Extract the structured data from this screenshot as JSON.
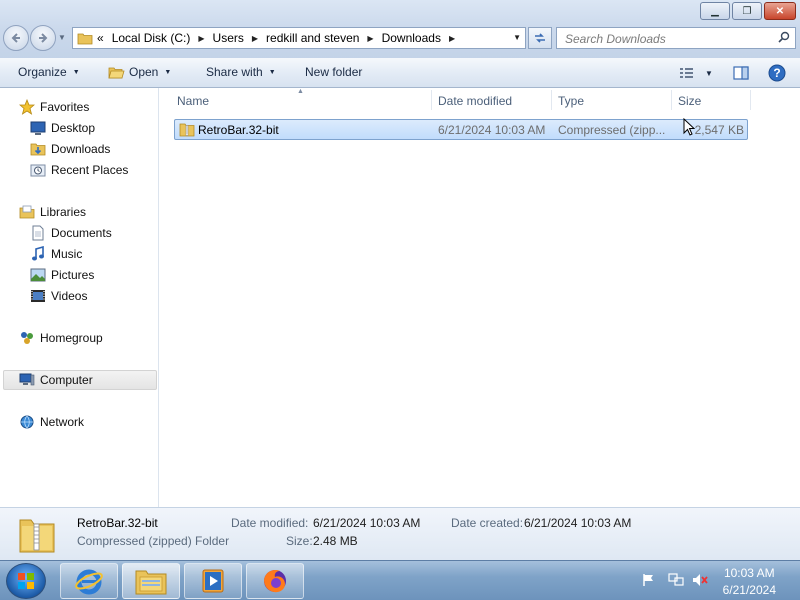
{
  "window": {
    "minimize": "▁",
    "maximize": "❐",
    "close": "✕"
  },
  "address": {
    "overflow": "«",
    "crumbs": [
      "Local Disk (C:)",
      "Users",
      "redkill and steven",
      "Downloads"
    ],
    "search_placeholder": "Search Downloads"
  },
  "toolbar": {
    "organize": "Organize",
    "open": "Open",
    "share_with": "Share with",
    "new_folder": "New folder"
  },
  "nav": {
    "favorites": "Favorites",
    "desktop": "Desktop",
    "downloads": "Downloads",
    "recent_places": "Recent Places",
    "libraries": "Libraries",
    "documents": "Documents",
    "music": "Music",
    "pictures": "Pictures",
    "videos": "Videos",
    "homegroup": "Homegroup",
    "computer": "Computer",
    "network": "Network"
  },
  "columns": {
    "name": "Name",
    "date_modified": "Date modified",
    "type": "Type",
    "size": "Size"
  },
  "files": [
    {
      "name": "RetroBar.32-bit",
      "date_modified": "6/21/2024 10:03 AM",
      "type": "Compressed (zipp...",
      "size": "2,547 KB"
    }
  ],
  "details": {
    "name": "RetroBar.32-bit",
    "kind": "Compressed (zipped) Folder",
    "date_modified_label": "Date modified:",
    "date_modified": "6/21/2024 10:03 AM",
    "date_created_label": "Date created:",
    "date_created": "6/21/2024 10:03 AM",
    "size_label": "Size:",
    "size": "2.48 MB"
  },
  "taskbar": {
    "time": "10:03 AM",
    "date": "6/21/2024"
  },
  "colors": {
    "selection": "#cce4fc",
    "accent": "#3b6cb3"
  }
}
